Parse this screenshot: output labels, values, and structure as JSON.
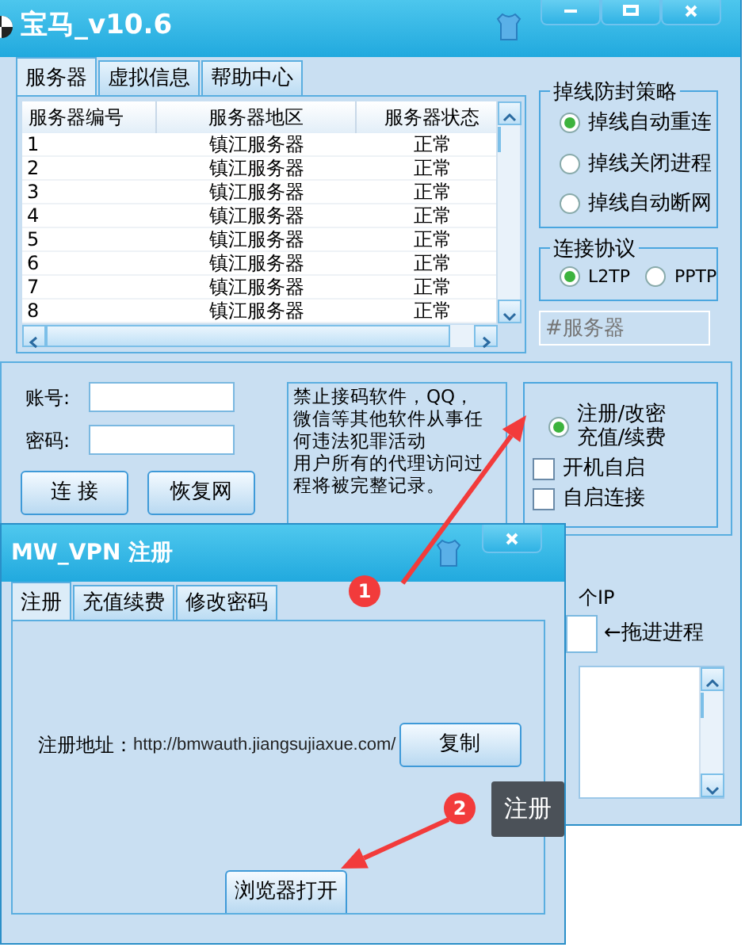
{
  "main_window": {
    "title": "宝马_v10.6",
    "tabs": [
      {
        "label": "服务器",
        "selected": true
      },
      {
        "label": "虚拟信息",
        "selected": false
      },
      {
        "label": "帮助中心",
        "selected": false
      }
    ],
    "server_table": {
      "columns": [
        "服务器编号",
        "服务器地区",
        "服务器状态"
      ],
      "rows": [
        [
          "1",
          "镇江服务器",
          "正常"
        ],
        [
          "2",
          "镇江服务器",
          "正常"
        ],
        [
          "3",
          "镇江服务器",
          "正常"
        ],
        [
          "4",
          "镇江服务器",
          "正常"
        ],
        [
          "5",
          "镇江服务器",
          "正常"
        ],
        [
          "6",
          "镇江服务器",
          "正常"
        ],
        [
          "7",
          "镇江服务器",
          "正常"
        ],
        [
          "8",
          "镇江服务器",
          "正常"
        ]
      ]
    },
    "drop_policy": {
      "title": "掉线防封策略",
      "options": [
        {
          "label": "掉线自动重连",
          "selected": true
        },
        {
          "label": "掉线关闭进程",
          "selected": false
        },
        {
          "label": "掉线自动断网",
          "selected": false
        }
      ]
    },
    "protocol": {
      "title": "连接协议",
      "options": [
        {
          "label": "L2TP",
          "selected": true
        },
        {
          "label": "PPTP",
          "selected": false
        }
      ]
    },
    "server_field": {
      "placeholder": "#服务器"
    },
    "login": {
      "fields": [
        {
          "label": "账号:"
        },
        {
          "label": "密码:"
        }
      ],
      "buttons": [
        "连 接",
        "恢复网"
      ]
    },
    "notice": [
      "禁止接码软件，QQ，微信等其他软件从事任何违法犯罪活动",
      "用户所有的代理访问过程将被完整记录。"
    ],
    "options": [
      {
        "kind": "radio",
        "lines": [
          "注册/改密",
          "充值/续费"
        ],
        "checked": true
      },
      {
        "kind": "checkbox",
        "lines": [
          "开机自启"
        ],
        "checked": false
      },
      {
        "kind": "checkbox",
        "lines": [
          "自启连接"
        ],
        "checked": false
      }
    ],
    "ip_label": "个IP",
    "drag_hint": "←拖进进程"
  },
  "dialog": {
    "title": "MW_VPN 注册",
    "tabs": [
      {
        "label": "注册",
        "selected": true
      },
      {
        "label": "充值续费",
        "selected": false
      },
      {
        "label": "修改密码",
        "selected": false
      }
    ],
    "address_label": "注册地址：",
    "address": "http://bmwauth.jiangsujiaxue.com/",
    "buttons": [
      "复制",
      "浏览器打开"
    ]
  },
  "annotations": {
    "steps": [
      {
        "label": "1"
      },
      {
        "label": "2"
      }
    ],
    "tooltip": "注册"
  }
}
